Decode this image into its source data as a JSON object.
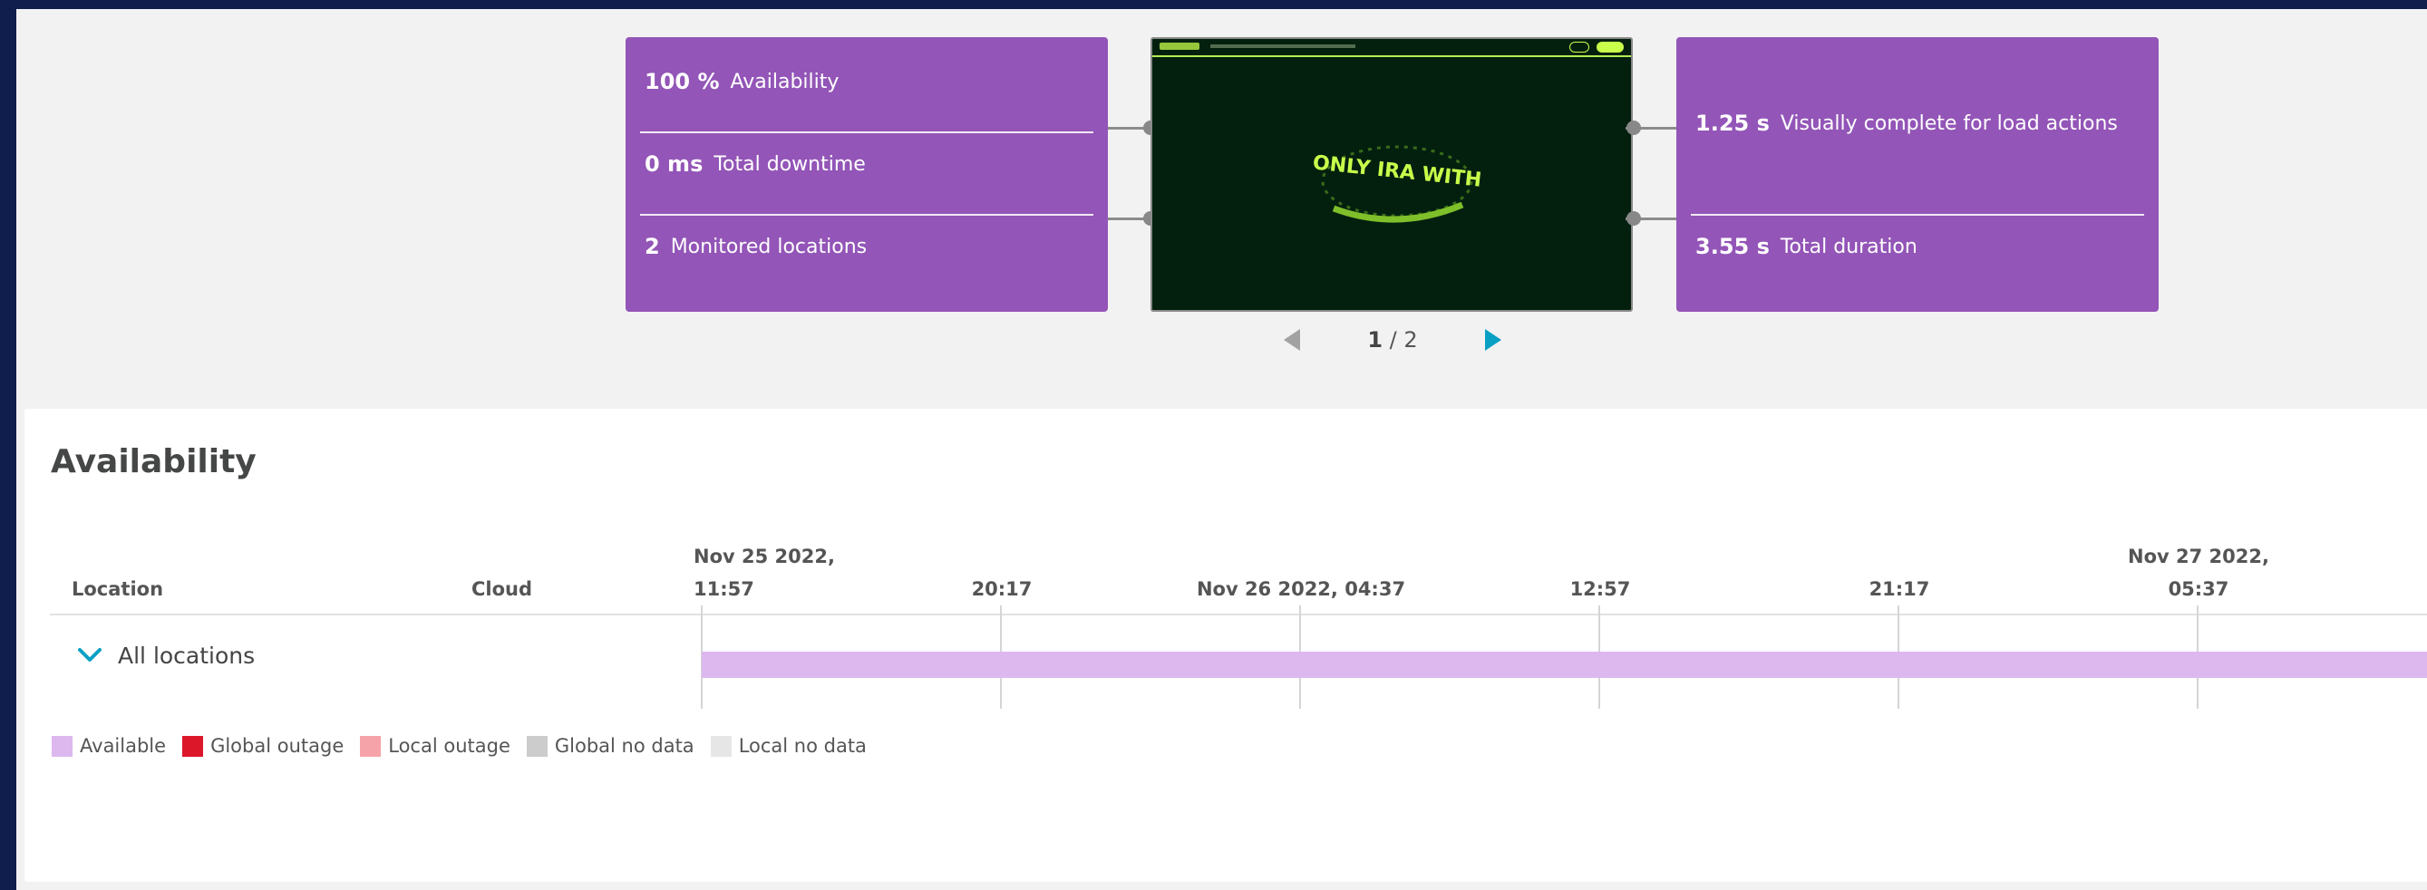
{
  "summary": {
    "left_metrics": [
      {
        "value": "100 %",
        "label": "Availability"
      },
      {
        "value": "0 ms",
        "label": "Total downtime"
      },
      {
        "value": "2",
        "label": "Monitored locations"
      }
    ],
    "screenshot_text": "ONLY IRA WITH",
    "right_metrics": [
      {
        "value": "1.25 s",
        "label": "Visually complete for load actions"
      },
      {
        "value": "3.55 s",
        "label": "Total duration"
      }
    ],
    "pager": {
      "current": "1",
      "separator": "/ 2"
    }
  },
  "availability": {
    "title": "Availability",
    "columns": {
      "location": "Location",
      "cloud": "Cloud"
    },
    "timeline_ticks": [
      {
        "line1": "Nov 25 2022,",
        "line2": "11:57"
      },
      {
        "line1": "",
        "line2": "20:17"
      },
      {
        "line1": "",
        "line2": "Nov 26 2022, 04:37"
      },
      {
        "line1": "",
        "line2": "12:57"
      },
      {
        "line1": "",
        "line2": "21:17"
      },
      {
        "line1": "Nov 27 2022,",
        "line2": "05:37"
      }
    ],
    "group_label": "All locations",
    "status": "Available",
    "legend": [
      {
        "label": "Available",
        "color": "#dcb8ef"
      },
      {
        "label": "Global outage",
        "color": "#dc172a"
      },
      {
        "label": "Local outage",
        "color": "#f5a3a8"
      },
      {
        "label": "Global no data",
        "color": "#cccccc"
      },
      {
        "label": "Local no data",
        "color": "#e6e6e6"
      }
    ]
  },
  "colors": {
    "accent_purple": "#9355b7",
    "pager_active": "#0aa0c4",
    "page_bg": "#0f1e4d"
  }
}
